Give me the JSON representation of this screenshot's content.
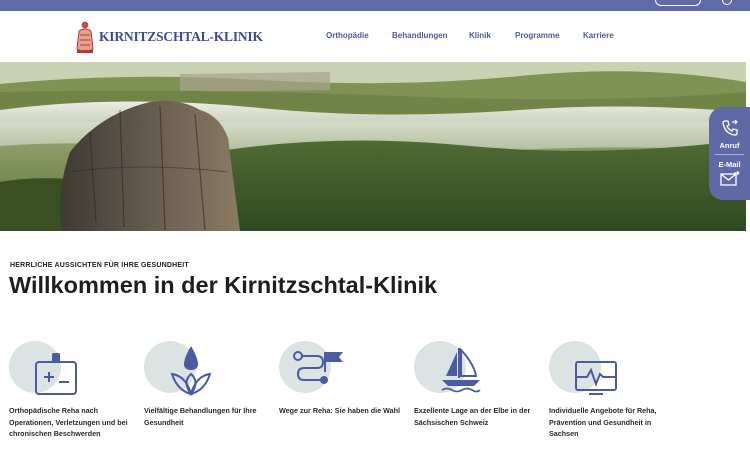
{
  "header": {
    "logo_text": "KIRNITZSCHTAL-KLINIK",
    "nav": [
      "Orthopädie",
      "Behandlungen",
      "Klinik",
      "Programme",
      "Karriere"
    ]
  },
  "hero": {
    "alt": "Felslandschaft im Kirnitzschtal"
  },
  "side_contact": {
    "call_label": "Anruf",
    "email_label": "E-Mail"
  },
  "intro": {
    "eyebrow": "HERRLICHE AUSSICHTEN FÜR IHRE GESUNDHEIT",
    "title": "Willkommen in der Kirnitzschtal-Klinik"
  },
  "features": [
    {
      "icon": "clipboard-plus-icon",
      "text": "Orthopädische Reha nach Operationen, Verletzungen und bei chronischen Beschwerden"
    },
    {
      "icon": "lotus-drop-icon",
      "text": "Vielfältige Behandlungen für Ihre Gesundheit"
    },
    {
      "icon": "route-flag-icon",
      "text": "Wege zur Reha: Sie haben die Wahl"
    },
    {
      "icon": "sailboat-icon",
      "text": "Exzellente Lage an der Elbe in der Sächsischen Schweiz"
    },
    {
      "icon": "monitor-pulse-icon",
      "text": "Individuelle Angebote für Reha, Prävention und Gesundheit in Sachsen"
    }
  ],
  "colors": {
    "brand": "#5f6aa6",
    "icon_line": "#4a5ba3",
    "icon_circle": "#dbe3e3"
  }
}
